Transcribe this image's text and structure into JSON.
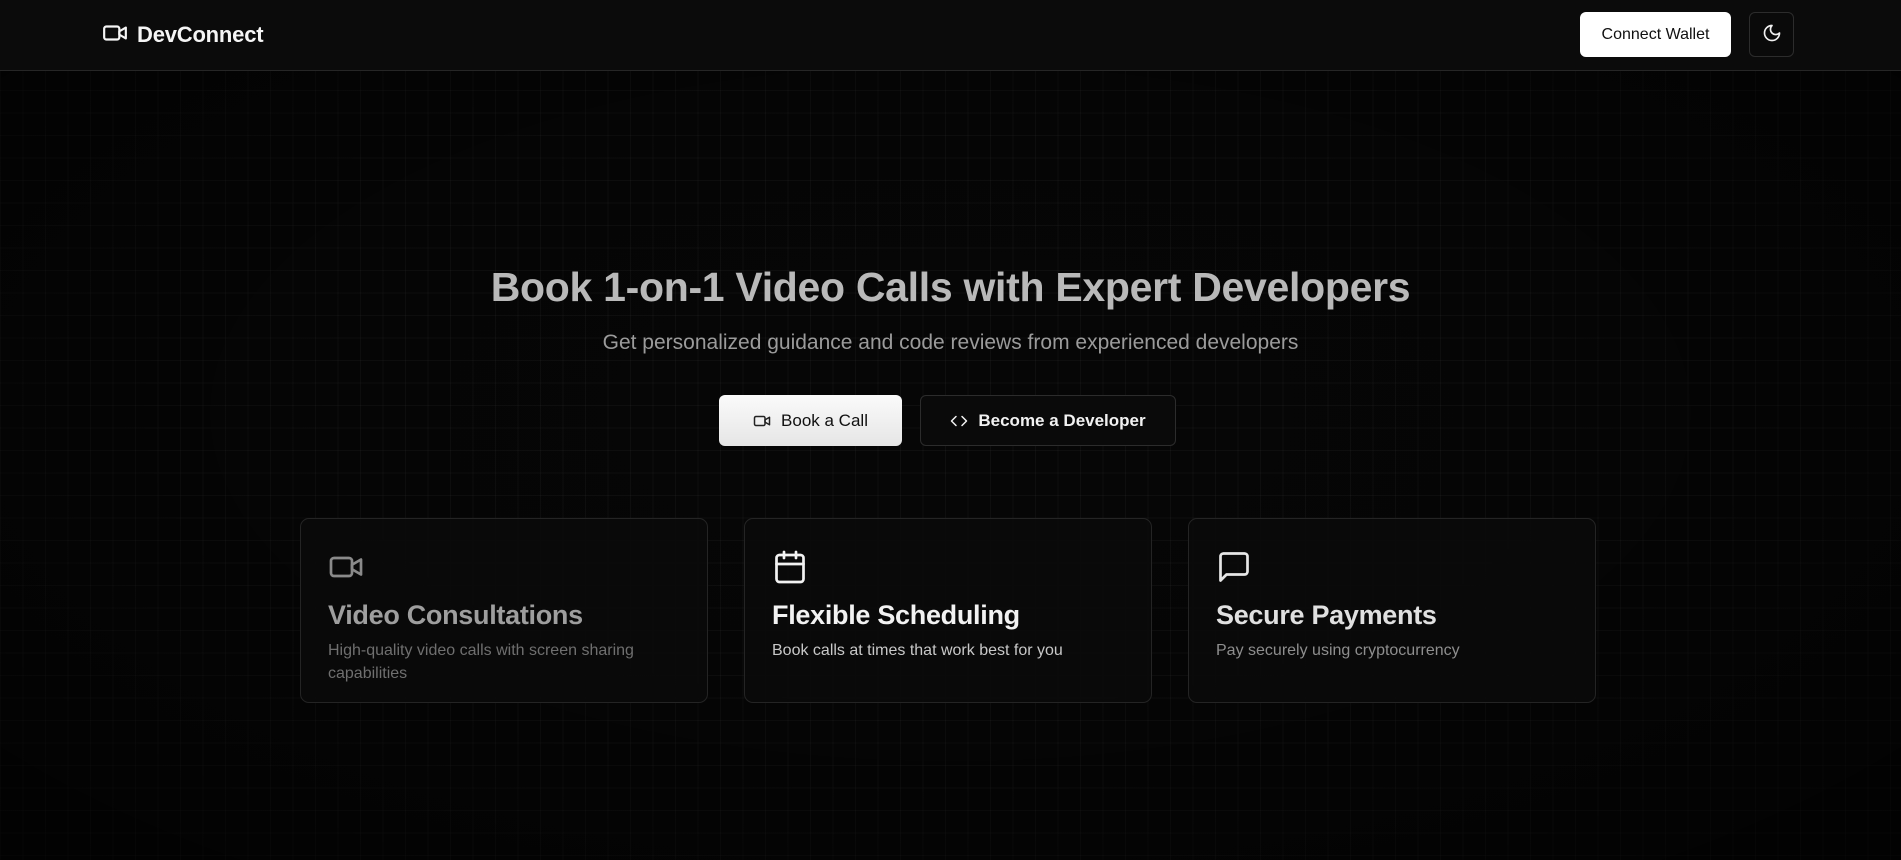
{
  "header": {
    "brand_name": "DevConnect",
    "brand_icon": "video-camera-icon",
    "connect_wallet_label": "Connect Wallet",
    "theme_toggle_icon": "moon-icon"
  },
  "hero": {
    "title": "Book 1-on-1 Video Calls with Expert Developers",
    "subtitle": "Get personalized guidance and code reviews from experienced developers",
    "book_call_label": "Book a Call",
    "book_call_icon": "video-camera-icon",
    "become_developer_label": "Become a Developer",
    "become_developer_icon": "code-icon"
  },
  "features": [
    {
      "icon": "video-camera-icon",
      "title": "Video Consultations",
      "description": "High-quality video calls with screen sharing capabilities"
    },
    {
      "icon": "calendar-icon",
      "title": "Flexible Scheduling",
      "description": "Book calls at times that work best for you"
    },
    {
      "icon": "message-square-icon",
      "title": "Secure Payments",
      "description": "Pay securely using cryptocurrency"
    }
  ],
  "colors": {
    "background": "#060606",
    "header_background": "#0b0b0b",
    "primary_button": "#ffffff",
    "border": "#262626"
  }
}
